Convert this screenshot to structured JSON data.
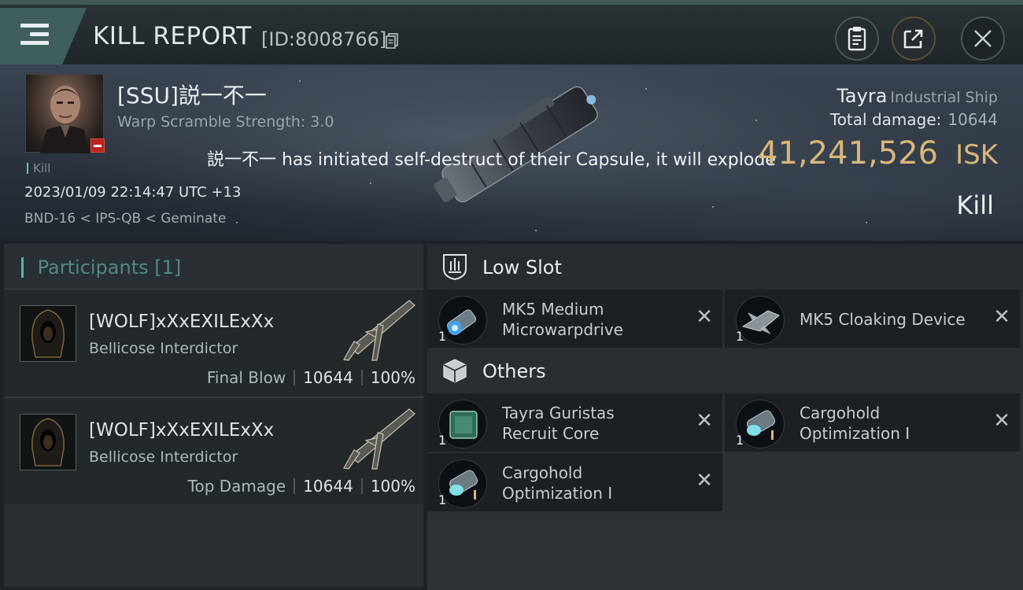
{
  "header": {
    "title": "KILL REPORT",
    "report_id": "[ID:8008766]",
    "icons": [
      "menu-icon",
      "copy-icon",
      "clipboard-icon",
      "share-icon",
      "close-icon"
    ]
  },
  "victim": {
    "name": "[SSU]説一不一",
    "warp_scramble": "Warp Scramble Strength: 3.0",
    "kill_tag": "Kill",
    "datetime": "2023/01/09 22:14:47 UTC +13",
    "location": "BND-16 < IPS-QB < Geminate",
    "self_destruct_message": "説一不一 has initiated self-destruct of their Capsule, it will explode",
    "ship_name": "Tayra",
    "ship_class": "Industrial Ship",
    "total_damage_label": "Total damage:",
    "total_damage_value": "10644",
    "isk_value": "41,241,526",
    "isk_unit": "ISK",
    "result": "Kill"
  },
  "participants": {
    "title": "Participants",
    "count": "[1]",
    "rows": [
      {
        "name": "[WOLF]xXxEXILExXx",
        "ship": "Bellicose Interdictor",
        "role": "Final Blow",
        "damage": "10644",
        "percent": "100%"
      },
      {
        "name": "[WOLF]xXxEXILExXx",
        "ship": "Bellicose Interdictor",
        "role": "Top Damage",
        "damage": "10644",
        "percent": "100%"
      }
    ]
  },
  "fitting": {
    "low_slot": {
      "title": "Low Slot",
      "items": [
        {
          "name_line1": "MK5 Medium",
          "name_line2": "Microwarpdrive",
          "qty": "1"
        },
        {
          "name_line1": "MK5 Cloaking Device",
          "name_line2": "",
          "qty": "1"
        }
      ]
    },
    "others": {
      "title": "Others",
      "items": [
        {
          "name_line1": "Tayra Guristas",
          "name_line2": "Recruit Core",
          "qty": "1"
        },
        {
          "name_line1": "Cargohold",
          "name_line2": "Optimization I",
          "qty": "1"
        },
        {
          "name_line1": "Cargohold",
          "name_line2": "Optimization I",
          "qty": "1"
        }
      ]
    }
  },
  "colors": {
    "accent_teal": "#56b8a6",
    "isk_gold": "#d9b77a",
    "kill_red": "#b8261f"
  }
}
